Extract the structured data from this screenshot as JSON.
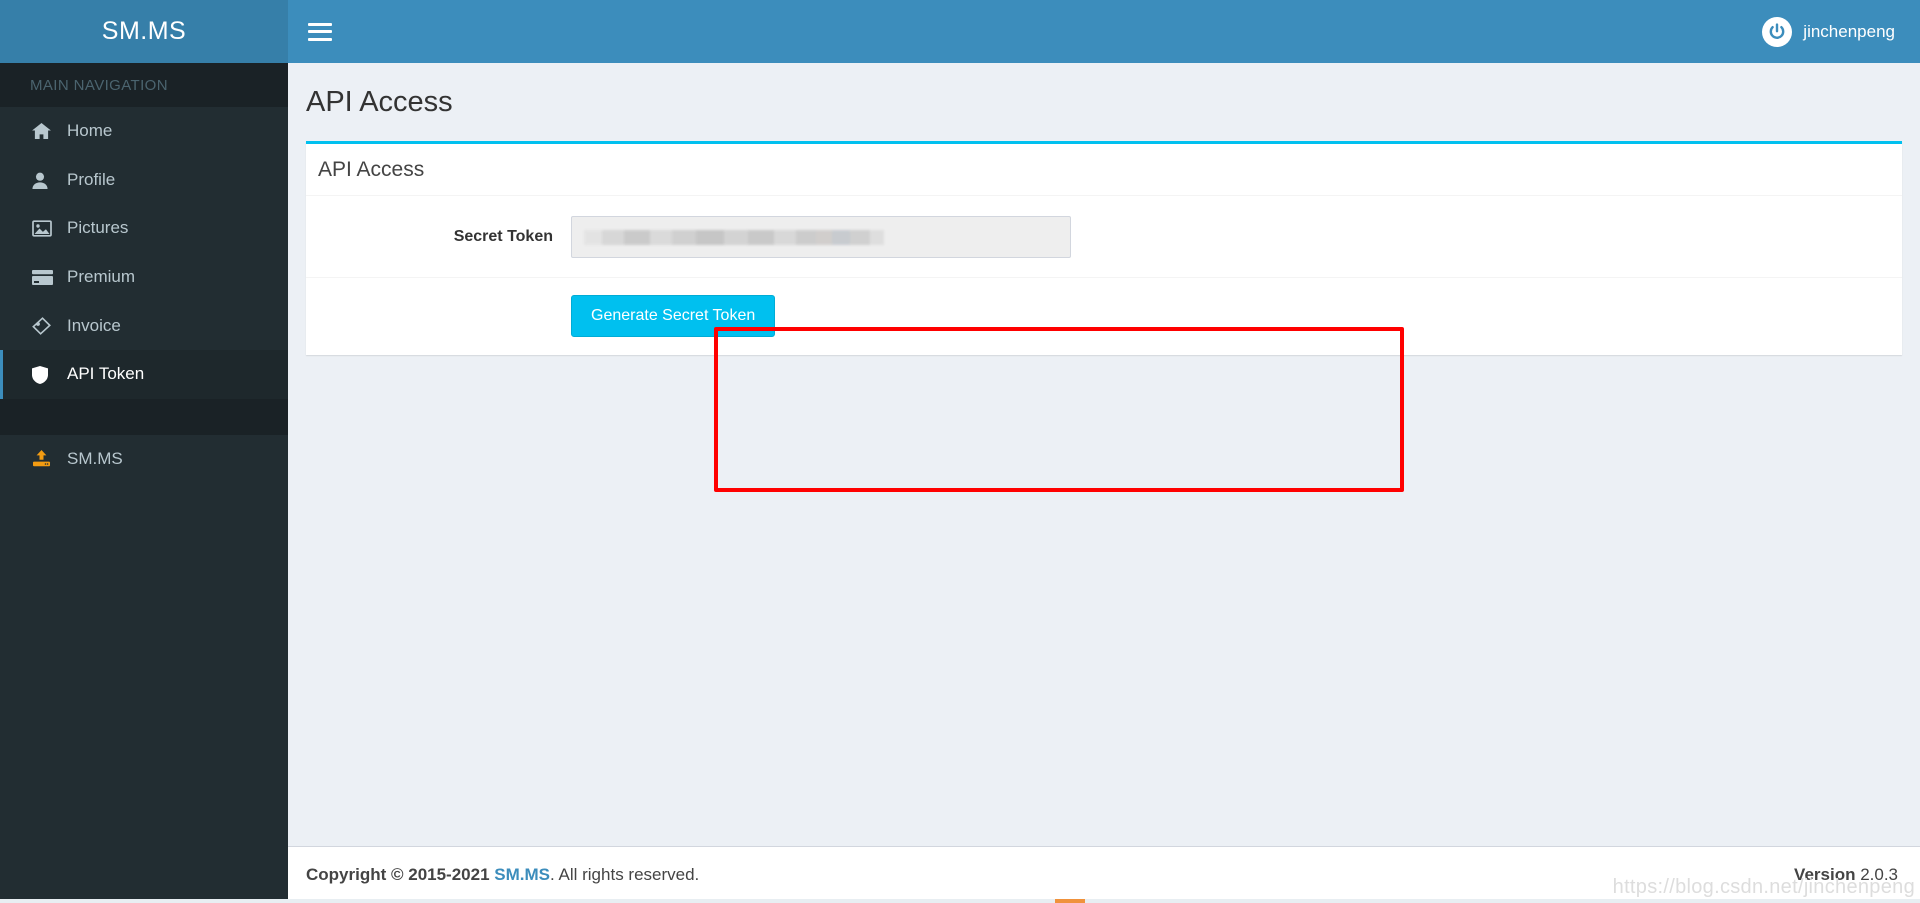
{
  "sidebar": {
    "logo": "SM.MS",
    "nav_header": "MAIN NAVIGATION",
    "items": [
      {
        "label": "Home",
        "icon": "home-icon",
        "active": false
      },
      {
        "label": "Profile",
        "icon": "user-icon",
        "active": false
      },
      {
        "label": "Pictures",
        "icon": "image-icon",
        "active": false
      },
      {
        "label": "Premium",
        "icon": "credit-card-icon",
        "active": false
      },
      {
        "label": "Invoice",
        "icon": "tag-icon",
        "active": false
      },
      {
        "label": "API Token",
        "icon": "shield-icon",
        "active": true
      }
    ],
    "upload_item": {
      "label": "SM.MS",
      "icon": "upload-icon"
    }
  },
  "topbar": {
    "menu_icon": "hamburger-icon",
    "user_icon": "power-icon",
    "username": "jinchenpeng"
  },
  "page": {
    "title": "API Access",
    "box_title": "API Access",
    "form": {
      "label": "Secret Token",
      "token_value": "",
      "token_placeholder": "",
      "button_label": "Generate Secret Token"
    }
  },
  "footer": {
    "copyright_prefix": "Copyright © 2015-2021 ",
    "brand": "SM.MS",
    "copyright_suffix": ". All rights reserved.",
    "version_label": "Version ",
    "version_number": "2.0.3",
    "watermark": "https://blog.csdn.net/jinchenpeng"
  },
  "colors": {
    "sidebar_bg": "#222d32",
    "header_blue": "#3c8dbc",
    "logo_blue": "#367fa9",
    "accent_cyan": "#00c0ef",
    "annotation_red": "#ff0000",
    "upload_orange": "#f39c12",
    "content_bg": "#ecf0f5"
  }
}
